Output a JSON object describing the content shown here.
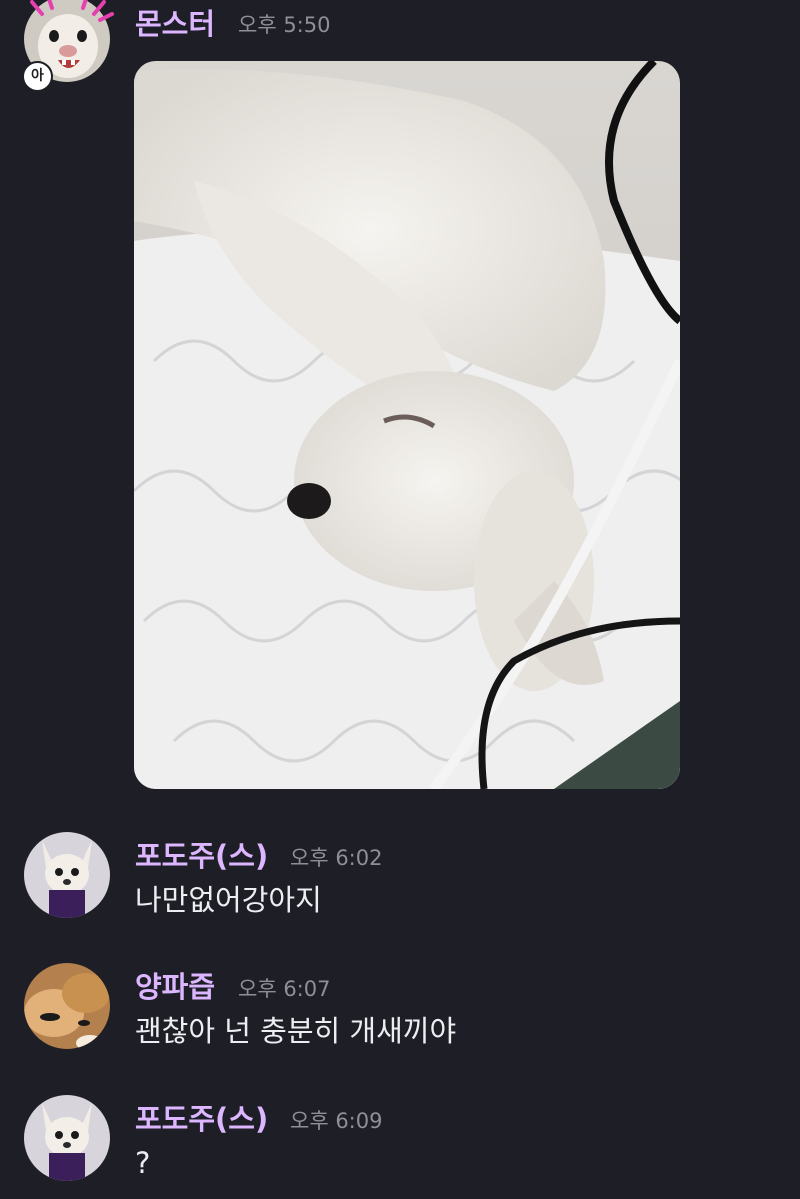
{
  "colors": {
    "background": "#1e1f26",
    "username": "#dcb6ff",
    "timestamp": "#8e8f98",
    "message_text": "#eceef2"
  },
  "messages": [
    {
      "username": "몬스터",
      "time": "오후 5:50",
      "text": "",
      "avatar": "chihuahua-screaming",
      "badge": "아",
      "attachment": "sleeping-white-dog-photo"
    },
    {
      "username": "포도주(스)",
      "time": "오후 6:02",
      "text": "나만없어강아지",
      "avatar": "chihuahua-purple-cloth"
    },
    {
      "username": "양파즙",
      "time": "오후 6:07",
      "text": "괜찮아 넌 충분히 개새끼야",
      "avatar": "shiba-dog"
    },
    {
      "username": "포도주(스)",
      "time": "오후 6:09",
      "text": "?",
      "avatar": "chihuahua-purple-cloth"
    }
  ]
}
